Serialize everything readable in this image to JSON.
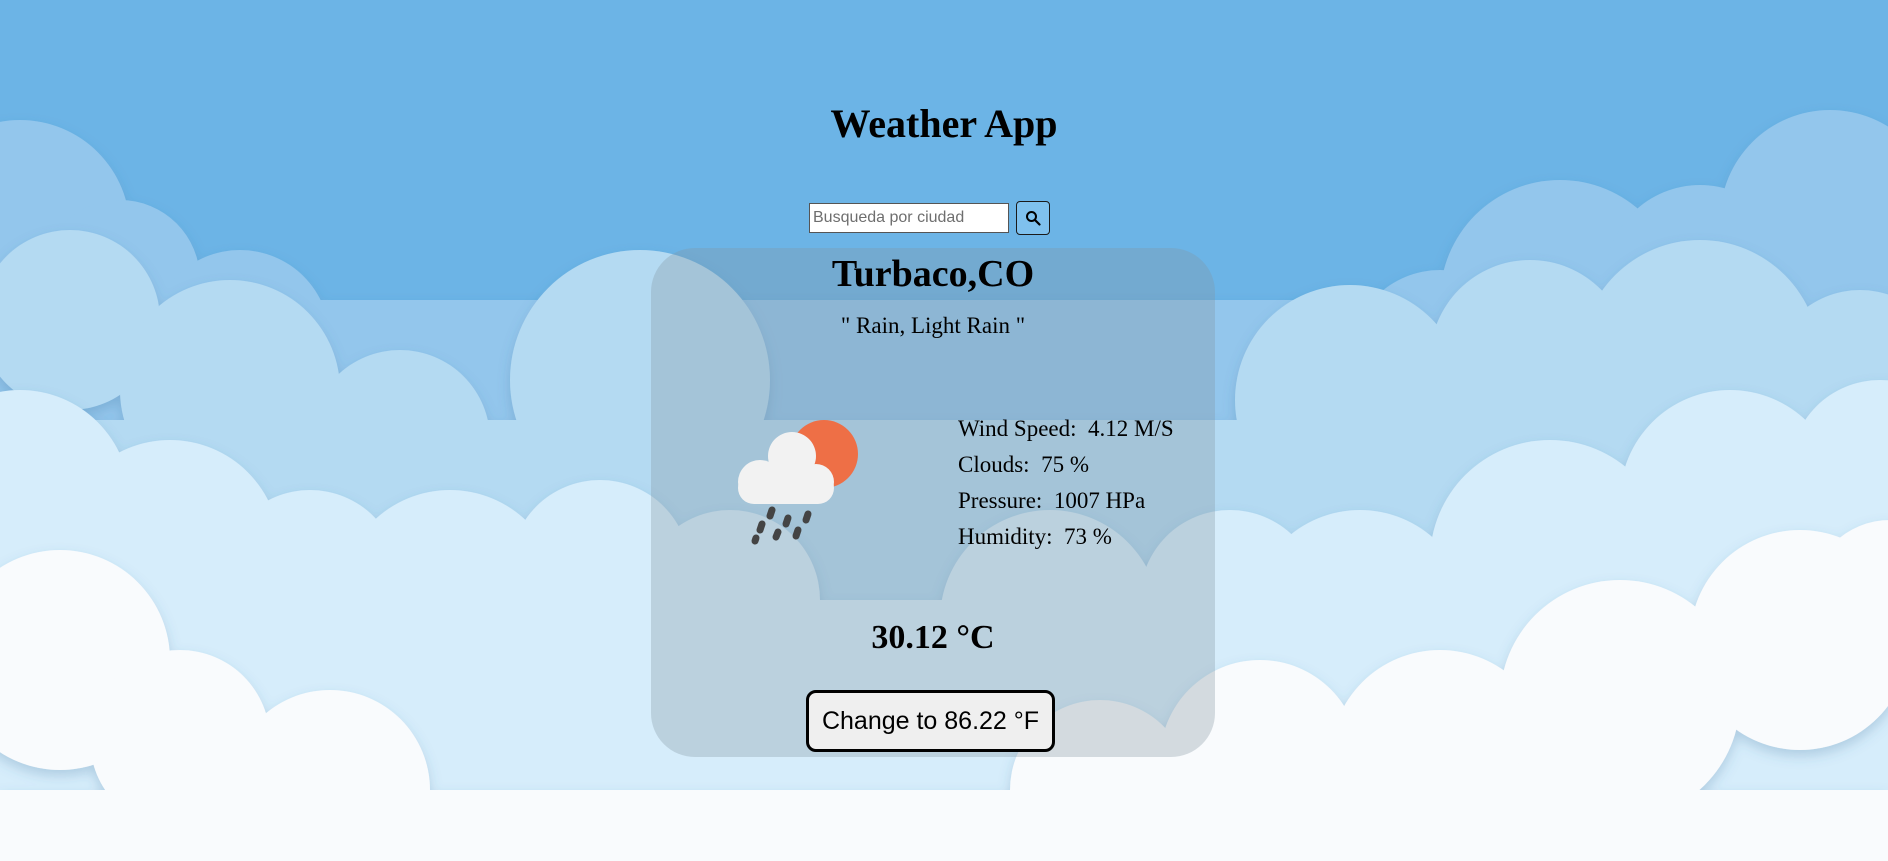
{
  "app": {
    "title": "Weather App"
  },
  "search": {
    "placeholder": "Busqueda por ciudad",
    "value": "",
    "icon": "search-icon"
  },
  "weather": {
    "location": "Turbaco,CO",
    "description": "\" Rain, Light Rain \"",
    "icon": "cloud-sun-rain-icon",
    "stats": {
      "wind": "Wind Speed:  4.12 M/S",
      "clouds": "Clouds:  75 %",
      "pressure": "Pressure:  1007 HPa",
      "humidity": "Humidity:  73 %"
    },
    "temperature": "30.12 °C",
    "toggle_label": "Change to 86.22 °F"
  },
  "colors": {
    "sky": "#6cb4e6",
    "cloud_far": "#9ccbee",
    "cloud_mid": "#b6dcf3",
    "cloud_near": "#d7eefb",
    "cloud_front": "#fafcfd",
    "sun": "#ee6f46",
    "rain": "#444444"
  }
}
